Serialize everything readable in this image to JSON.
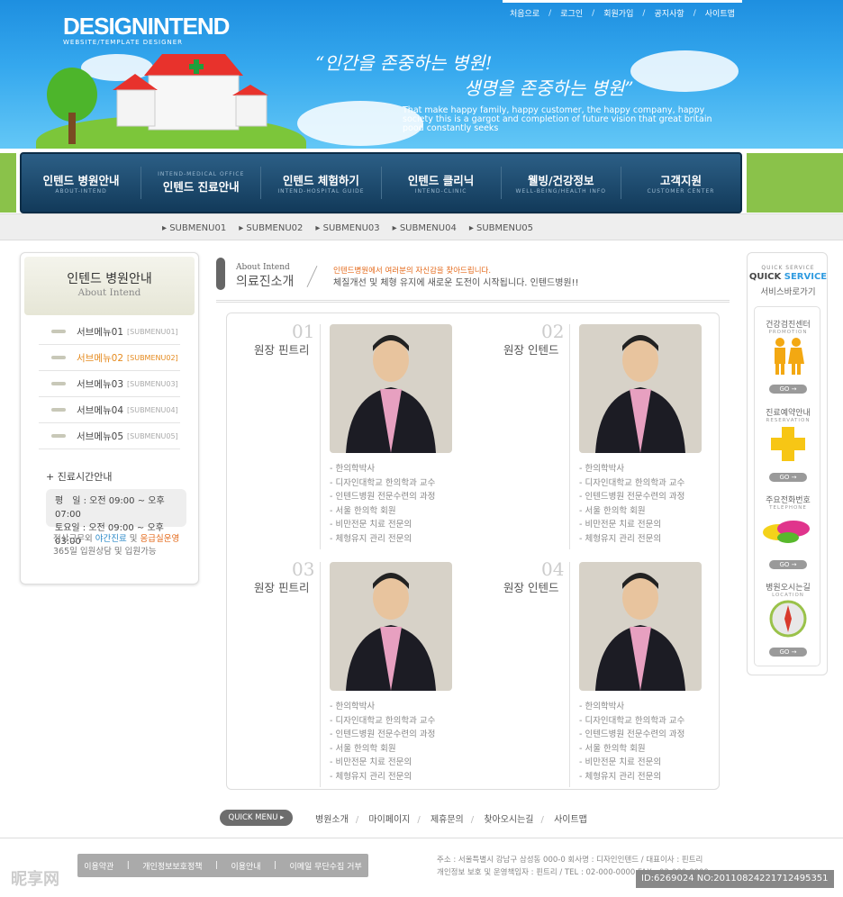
{
  "logo": {
    "main": "DESIGNINTEND",
    "sub": "WEBSITE/TEMPLATE DESIGNER"
  },
  "top_nav": [
    "처음으로",
    "로그인",
    "회원가입",
    "공지사항",
    "사이트맵"
  ],
  "slogan": {
    "line1": "“인간을 존중하는 병원!",
    "line2": "생명을 존중하는 병원”",
    "tagline": "That make happy family, happy customer, the happy company, happy society this is a gargot and completion of future vision that great britain pood constantly seeks"
  },
  "gnb": [
    {
      "top": "",
      "main": "인텐드 병원안내",
      "sub": "ABOUT-INTEND"
    },
    {
      "top": "INTEND-MEDICAL OFFICE",
      "main": "인텐드 진료안내",
      "sub": ""
    },
    {
      "top": "",
      "main": "인텐드 체험하기",
      "sub": "INTEND-HOSPITAL GUIDE"
    },
    {
      "top": "",
      "main": "인텐드 클리닉",
      "sub": "INTEND-CLINIC"
    },
    {
      "top": "",
      "main": "웰빙/건강정보",
      "sub": "WELL-BEING/HEALTH INFO"
    },
    {
      "top": "",
      "main": "고객지원",
      "sub": "CUSTOMER CENTER"
    }
  ],
  "submenu": [
    "SUBMENU01",
    "SUBMENU02",
    "SUBMENU03",
    "SUBMENU04",
    "SUBMENU05"
  ],
  "sidebar": {
    "title": "인텐드 병원안내",
    "subtitle": "About Intend",
    "items": [
      {
        "label": "서브메뉴01",
        "en": "[SUBMENU01]"
      },
      {
        "label": "서브메뉴02",
        "en": "[SUBMENU02]"
      },
      {
        "label": "서브메뉴03",
        "en": "[SUBMENU03]"
      },
      {
        "label": "서브메뉴04",
        "en": "[SUBMENU04]"
      },
      {
        "label": "서브메뉴05",
        "en": "[SUBMENU05]"
      }
    ],
    "hours_title": "진료시간안내",
    "hours_weekday": "평　일 : 오전 09:00 ~ 오후 07:00",
    "hours_saturday": "토요일 : 오전 09:00 ~ 오후 03:00",
    "note_prefix": "정상근무외 ",
    "note_night": "야간진료",
    "note_and": " 및 ",
    "note_er": "응급실운영",
    "note_line2": "365일 입원상담 및 입원가능"
  },
  "page": {
    "title_en": "About Intend",
    "title_ko": "의료진소개",
    "desc1": "인텐드병원에서 여러분의 자신감을 찾아드립니다.",
    "desc2": "체질개선 및 체형 유지에 새로운 도전이 시작됩니다. 인텐드병원!!"
  },
  "profiles": [
    {
      "num": "01",
      "name": "원장 핀트리",
      "items": [
        "- 한의학박사",
        "- 디자인대학교 한의학과 교수",
        "- 인텐드병원 전문수련의 과정",
        "- 서울 한의학 회원",
        "- 비만전문 치료 전문의",
        "- 체형유지 관리 전문의"
      ]
    },
    {
      "num": "02",
      "name": "원장 인텐드",
      "items": [
        "- 한의학박사",
        "- 디자인대학교 한의학과 교수",
        "- 인텐드병원 전문수련의 과정",
        "- 서울 한의학 회원",
        "- 비만전문 치료 전문의",
        "- 체형유지 관리 전문의"
      ]
    },
    {
      "num": "03",
      "name": "원장 핀트리",
      "items": [
        "- 한의학박사",
        "- 디자인대학교 한의학과 교수",
        "- 인텐드병원 전문수련의 과정",
        "- 서울 한의학 회원",
        "- 비만전문 치료 전문의",
        "- 체형유지 관리 전문의"
      ]
    },
    {
      "num": "04",
      "name": "원장 인텐드",
      "items": [
        "- 한의학박사",
        "- 디자인대학교 한의학과 교수",
        "- 인텐드병원 전문수련의 과정",
        "- 서울 한의학 회원",
        "- 비만전문 치료 전문의",
        "- 체형유지 관리 전문의"
      ]
    }
  ],
  "quick": {
    "label_en": "QUICK SERVICE",
    "label_quick": "QUICK",
    "label_service": "SERVICE",
    "label_ko": "서비스바로가기",
    "go": "GO →",
    "items": [
      {
        "ko": "건강검진센터",
        "en": "PROMOTION"
      },
      {
        "ko": "진료예약안내",
        "en": "RESERVATION"
      },
      {
        "ko": "주요전화번호",
        "en": "TELEPHONE"
      },
      {
        "ko": "병원오시는길",
        "en": "LOCATION"
      }
    ]
  },
  "quickmenu": {
    "button": "QUICK MENU ▸",
    "links": [
      "병원소개",
      "마이페이지",
      "제휴문의",
      "찾아오시는길",
      "사이트맵"
    ]
  },
  "footer": {
    "buttons": [
      "이용약관",
      "개인정보보호정책",
      "이용안내",
      "이메일 무단수집 거부"
    ],
    "addr1": "주소 : 서울특별시 강남구 삼성동 000-0  회사명 : 디자인인텐드 / 대표이사 : 핀트리",
    "addr2": "개인정보 보호 및 운영책임자 : 핀트리   /  TEL : 02-000-0000  FAX : 02-000-0000"
  },
  "watermark": {
    "logo": "昵享网",
    "id": "ID:6269024 NO:20110824221712495351"
  }
}
